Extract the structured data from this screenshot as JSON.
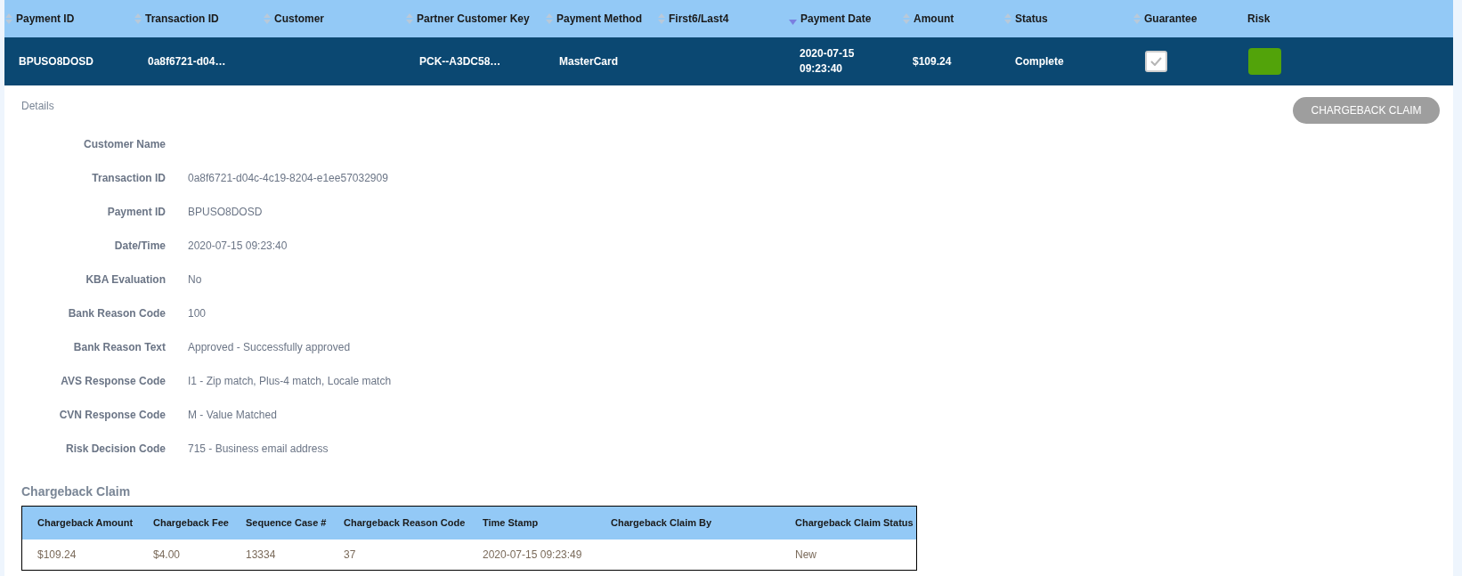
{
  "columns": [
    {
      "label": "Payment ID",
      "sortable": true,
      "sorted_descending": false
    },
    {
      "label": "Transaction ID",
      "sortable": true,
      "sorted_descending": false
    },
    {
      "label": "Customer",
      "sortable": true,
      "sorted_descending": false
    },
    {
      "label": "Partner Customer Key",
      "sortable": true,
      "sorted_descending": false
    },
    {
      "label": "Payment Method",
      "sortable": true,
      "sorted_descending": false
    },
    {
      "label": "First6/Last4",
      "sortable": true,
      "sorted_descending": false
    },
    {
      "label": "Payment Date",
      "sortable": true,
      "sorted_descending": true
    },
    {
      "label": "Amount",
      "sortable": true,
      "sorted_descending": false
    },
    {
      "label": "Status",
      "sortable": true,
      "sorted_descending": false
    },
    {
      "label": "Guarantee",
      "sortable": true,
      "sorted_descending": false
    },
    {
      "label": "Risk",
      "sortable": false
    }
  ],
  "row": {
    "selected": true,
    "payment_id": "BPUSO8DOSD",
    "transaction_id": "0a8f6721-d04…",
    "partner_customer_key": "PCK--A3DC58…",
    "payment_method": "MasterCard",
    "payment_date": [
      "2020-07-15",
      "09:23:40"
    ],
    "amount": "$109.24",
    "status": "Complete",
    "guarantee_checked": true,
    "risk": {
      "color": "#52a30a"
    }
  },
  "details": {
    "title": "Details",
    "button": "CHARGEBACK CLAIM",
    "fields": [
      {
        "label": "Customer Name"
      },
      {
        "label": "Transaction ID",
        "value": "0a8f6721-d04c-4c19-8204-e1ee57032909"
      },
      {
        "label": "Payment ID",
        "value": "BPUSO8DOSD"
      },
      {
        "label": "Date/Time",
        "value": "2020-07-15 09:23:40"
      },
      {
        "label": "KBA Evaluation",
        "value": "No"
      },
      {
        "label": "Bank Reason Code",
        "value": "100"
      },
      {
        "label": "Bank Reason Text",
        "value": "Approved - Successfully approved"
      },
      {
        "label": "AVS Response Code",
        "value": "I1 - Zip match, Plus-4 match, Locale match"
      },
      {
        "label": "CVN Response Code",
        "value": "M - Value Matched"
      },
      {
        "label": "Risk Decision Code",
        "value": "715 - Business email address"
      }
    ]
  },
  "chargeback": {
    "title": "Chargeback Claim",
    "columns": [
      "Chargeback Amount",
      "Chargeback Fee",
      "Sequence Case #",
      "Chargeback Reason Code",
      "Time Stamp",
      "Chargeback Claim By",
      "Chargeback Claim Status"
    ],
    "rows": [
      [
        "$109.24",
        "$4.00",
        "13334",
        "37",
        "2020-07-15 09:23:49",
        "",
        "New"
      ]
    ]
  }
}
